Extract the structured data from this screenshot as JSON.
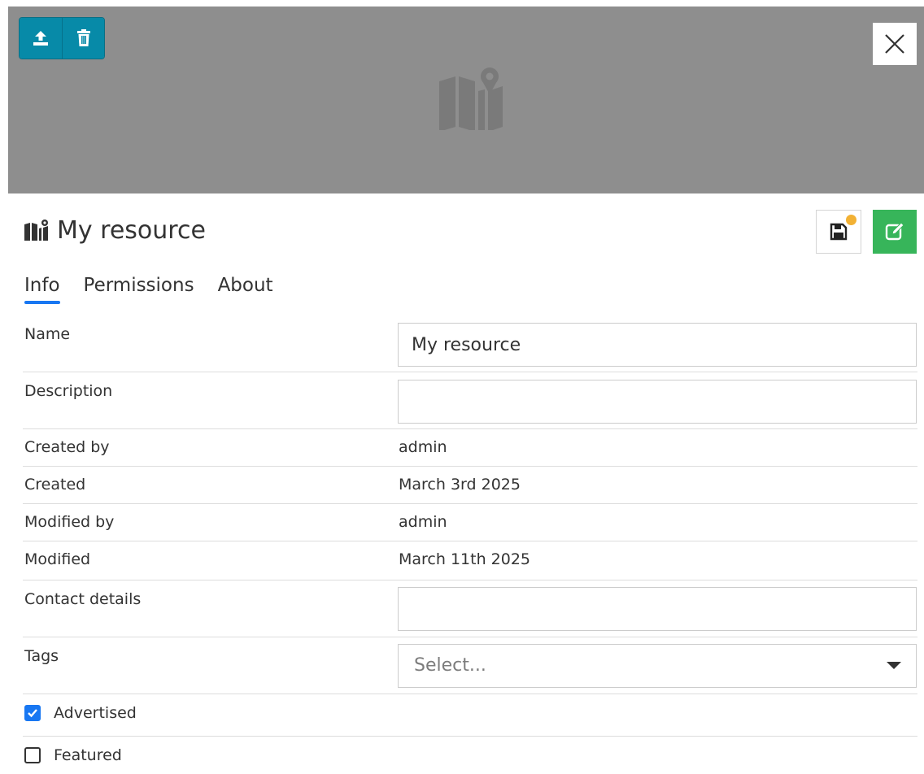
{
  "header": {
    "upload_icon": "upload-icon",
    "delete_icon": "trash-icon",
    "placeholder_icon": "map-marker-icon",
    "close_icon": "close-icon"
  },
  "title": {
    "icon": "map-icon",
    "text": "My resource",
    "save_icon": "floppy-disk-icon",
    "edit_icon": "edit-icon"
  },
  "tabs": [
    {
      "label": "Info",
      "active": true
    },
    {
      "label": "Permissions",
      "active": false
    },
    {
      "label": "About",
      "active": false
    }
  ],
  "form": {
    "name": {
      "label": "Name",
      "value": "My resource"
    },
    "description": {
      "label": "Description",
      "value": ""
    },
    "created_by": {
      "label": "Created by",
      "value": "admin"
    },
    "created": {
      "label": "Created",
      "value": "March 3rd 2025"
    },
    "modified_by": {
      "label": "Modified by",
      "value": "admin"
    },
    "modified": {
      "label": "Modified",
      "value": "March 11th 2025"
    },
    "contact": {
      "label": "Contact details",
      "value": ""
    },
    "tags": {
      "label": "Tags",
      "placeholder": "Select..."
    },
    "advertised": {
      "label": "Advertised",
      "checked": true
    },
    "featured": {
      "label": "Featured",
      "checked": false
    }
  },
  "colors": {
    "accent": "#078aa8",
    "edit": "#37b55a",
    "tab_active": "#1877f2",
    "dirty_indicator": "#f2b134",
    "header_bg": "#8e8e8e"
  }
}
